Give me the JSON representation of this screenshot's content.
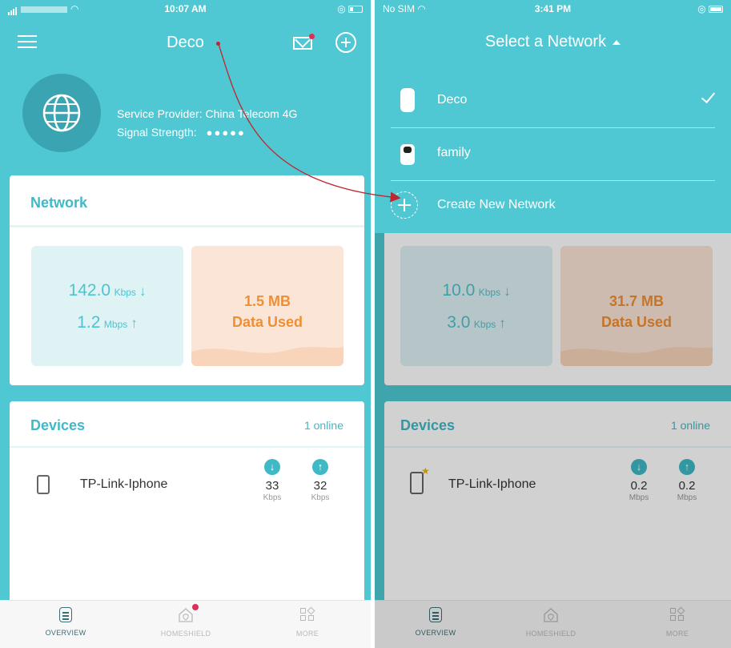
{
  "left": {
    "status": {
      "time": "10:07 AM"
    },
    "header": {
      "title": "Deco"
    },
    "provider": {
      "service_text": "Service Provider: China Telecom 4G",
      "signal_label": "Signal Strength:",
      "signal_dots": "●●●●●"
    },
    "network": {
      "header": "Network",
      "download_value": "142.0",
      "download_unit": "Kbps",
      "upload_value": "1.2",
      "upload_unit": "Mbps",
      "data_amount": "1.5 MB",
      "data_label": "Data Used"
    },
    "devices": {
      "header": "Devices",
      "online": "1 online",
      "items": [
        {
          "name": "TP-Link-Iphone",
          "down_value": "33",
          "down_unit": "Kbps",
          "up_value": "32",
          "up_unit": "Kbps"
        }
      ]
    },
    "tabs": [
      {
        "label": "OVERVIEW",
        "icon": "overview-icon",
        "active": true
      },
      {
        "label": "HOMESHIELD",
        "icon": "homeshield-icon",
        "active": false
      },
      {
        "label": "MORE",
        "icon": "more-icon",
        "active": false
      }
    ]
  },
  "right": {
    "status": {
      "carrier": "No SIM",
      "time": "3:41 PM"
    },
    "dropdown": {
      "title": "Select a Network",
      "networks": [
        {
          "label": "Deco",
          "icon": "deco-unit-icon",
          "selected": true
        },
        {
          "label": "family",
          "icon": "deco-unit-icon",
          "selected": false
        }
      ],
      "create_label": "Create New Network"
    },
    "network": {
      "download_value": "10.0",
      "download_unit": "Kbps",
      "upload_value": "3.0",
      "upload_unit": "Kbps",
      "data_amount": "31.7 MB",
      "data_label": "Data Used"
    },
    "devices": {
      "header": "Devices",
      "online": "1 online",
      "items": [
        {
          "name": "TP-Link-Iphone",
          "down_value": "0.2",
          "down_unit": "Mbps",
          "up_value": "0.2",
          "up_unit": "Mbps"
        }
      ]
    },
    "tabs": [
      {
        "label": "OVERVIEW",
        "icon": "overview-icon",
        "active": true
      },
      {
        "label": "HOMESHIELD",
        "icon": "homeshield-icon",
        "active": false
      },
      {
        "label": "MORE",
        "icon": "more-icon",
        "active": false
      }
    ]
  },
  "colors": {
    "teal": "#4fc8d3",
    "teal_text": "#3fb9c6",
    "orange": "#f08f32",
    "annotation_arrow": "#c0262d"
  },
  "arrows": {
    "down": "↓",
    "up": "↑"
  }
}
